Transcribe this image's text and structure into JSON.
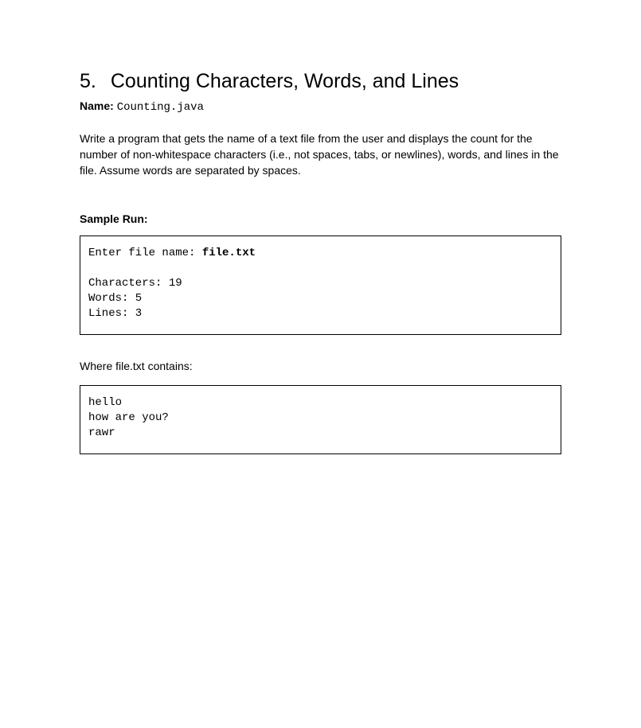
{
  "heading": {
    "number": "5.",
    "title": "Counting Characters, Words, and Lines"
  },
  "name": {
    "label": "Name:",
    "value": "Counting.java"
  },
  "description": "Write a program that gets the name of a text file from the user and displays the count for the number of non-whitespace characters (i.e., not spaces, tabs, or newlines), words, and lines in the file. Assume words are separated by spaces.",
  "sampleRun": {
    "label": "Sample Run:",
    "prompt": "Enter file name: ",
    "input": "file.txt",
    "line1": "Characters: 19",
    "line2": "Words: 5",
    "line3": "Lines: 3"
  },
  "fileNote": "Where file.txt contains:",
  "fileContents": {
    "line1": "hello",
    "line2": "how are you?",
    "line3": "rawr"
  }
}
